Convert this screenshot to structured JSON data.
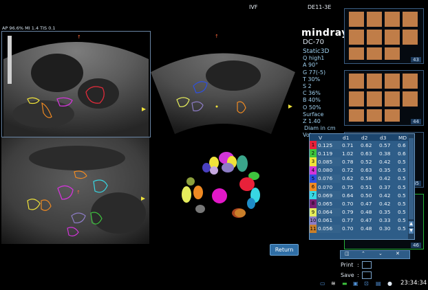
{
  "header": {
    "left_text": "IVF",
    "right_text": "DE11-3E"
  },
  "acoustic": "AP 96.6%  MI 1.4  TIS 0.1",
  "brand": {
    "name": "mindray",
    "model": "DC-70"
  },
  "params": {
    "mode": "Static3D",
    "lines": [
      "Q high1",
      "A 90°",
      "G 77(-5)",
      "T 30%",
      "S 2",
      "C 36%",
      "B 40%",
      "O 50%",
      "Surface",
      "Z 1.40",
      "Diam in cm",
      "Volu"
    ]
  },
  "thumbs": [
    "43",
    "44",
    "45",
    "46"
  ],
  "table": {
    "headers": [
      "V",
      "d1",
      "d2",
      "d3",
      "MD"
    ],
    "rows": [
      {
        "id": "1",
        "color": "#e8213a",
        "v": "0.125",
        "d1": "0.71",
        "d2": "0.62",
        "d3": "0.57",
        "md": "0.6"
      },
      {
        "id": "2",
        "color": "#3ec33e",
        "v": "0.119",
        "d1": "1.02",
        "d2": "0.63",
        "d3": "0.38",
        "md": "0.6"
      },
      {
        "id": "3",
        "color": "#f0e33a",
        "v": "0.085",
        "d1": "0.78",
        "d2": "0.52",
        "d3": "0.42",
        "md": "0.5"
      },
      {
        "id": "4",
        "color": "#d235d8",
        "v": "0.080",
        "d1": "0.72",
        "d2": "0.63",
        "d3": "0.35",
        "md": "0.5"
      },
      {
        "id": "5",
        "color": "#2d4fe0",
        "v": "0.076",
        "d1": "0.62",
        "d2": "0.58",
        "d3": "0.42",
        "md": "0.5"
      },
      {
        "id": "6",
        "color": "#f08a22",
        "v": "0.070",
        "d1": "0.75",
        "d2": "0.51",
        "d3": "0.37",
        "md": "0.5"
      },
      {
        "id": "7",
        "color": "#38d7e3",
        "v": "0.069",
        "d1": "0.64",
        "d2": "0.50",
        "d3": "0.42",
        "md": "0.5"
      },
      {
        "id": "8",
        "color": "#7a1f73",
        "v": "0.065",
        "d1": "0.70",
        "d2": "0.47",
        "d3": "0.42",
        "md": "0.5"
      },
      {
        "id": "9",
        "color": "#e5ec5c",
        "v": "0.064",
        "d1": "0.79",
        "d2": "0.48",
        "d3": "0.35",
        "md": "0.5"
      },
      {
        "id": "10",
        "color": "#8d7cc6",
        "v": "0.061",
        "d1": "0.77",
        "d2": "0.47",
        "d3": "0.33",
        "md": "0.5"
      },
      {
        "id": "11",
        "color": "#c97f2a",
        "v": "0.056",
        "d1": "0.70",
        "d2": "0.48",
        "d3": "0.30",
        "md": "0.5"
      }
    ]
  },
  "buttons": {
    "return": "Return"
  },
  "actions": {
    "print": "Print",
    "save": "Save"
  },
  "clock": "23:34:34"
}
